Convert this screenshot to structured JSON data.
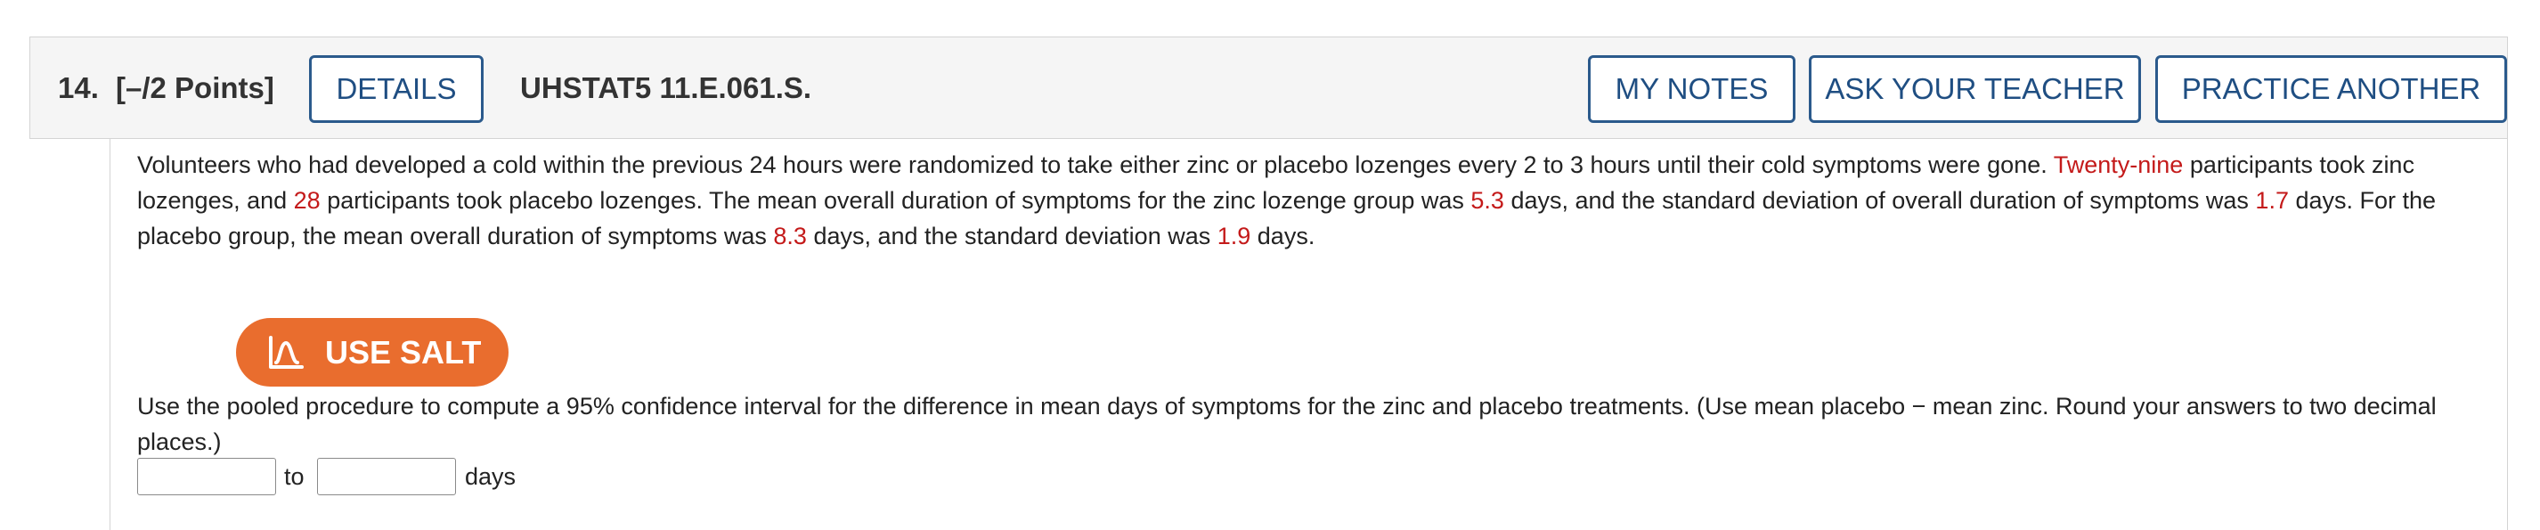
{
  "header": {
    "number": "14.",
    "points": "[–/2 Points]",
    "details_label": "DETAILS",
    "code": "UHSTAT5 11.E.061.S.",
    "my_notes_label": "MY NOTES",
    "ask_teacher_label": "ASK YOUR TEACHER",
    "practice_label": "PRACTICE ANOTHER"
  },
  "problem": {
    "s1": "Volunteers who had developed a cold within the previous 24 hours were randomized to take either zinc or placebo lozenges every 2 to 3 hours until their cold symptoms were gone. ",
    "v_zinc_n": "Twenty-nine",
    "s2": " participants took zinc lozenges, and ",
    "v_placebo_n": "28",
    "s3": " participants took placebo lozenges. The mean overall duration of symptoms for the zinc lozenge group was ",
    "v_zinc_mean": "5.3",
    "s4": " days, and the standard deviation of overall duration of symptoms was ",
    "v_zinc_sd": "1.7",
    "s5": " days. For the placebo group, the mean overall duration of symptoms was ",
    "v_placebo_mean": "8.3",
    "s6": " days, and the standard deviation was ",
    "v_placebo_sd": "1.9",
    "s7": " days."
  },
  "salt": {
    "label": "USE SALT",
    "icon": "salt-distribution-icon",
    "color": "#e96d2e"
  },
  "instructions": "Use the pooled procedure to compute a 95% confidence interval for the difference in mean days of symptoms for the zinc and placebo treatments. (Use mean placebo − mean zinc. Round your answers to two decimal places.)",
  "answer": {
    "lower_value": "",
    "upper_value": "",
    "separator": "to",
    "units": "days"
  },
  "colors": {
    "button_border": "#2b5a8c",
    "button_text": "#1f4e82",
    "highlight_value": "#c41a1a",
    "header_background": "#f5f5f5"
  }
}
